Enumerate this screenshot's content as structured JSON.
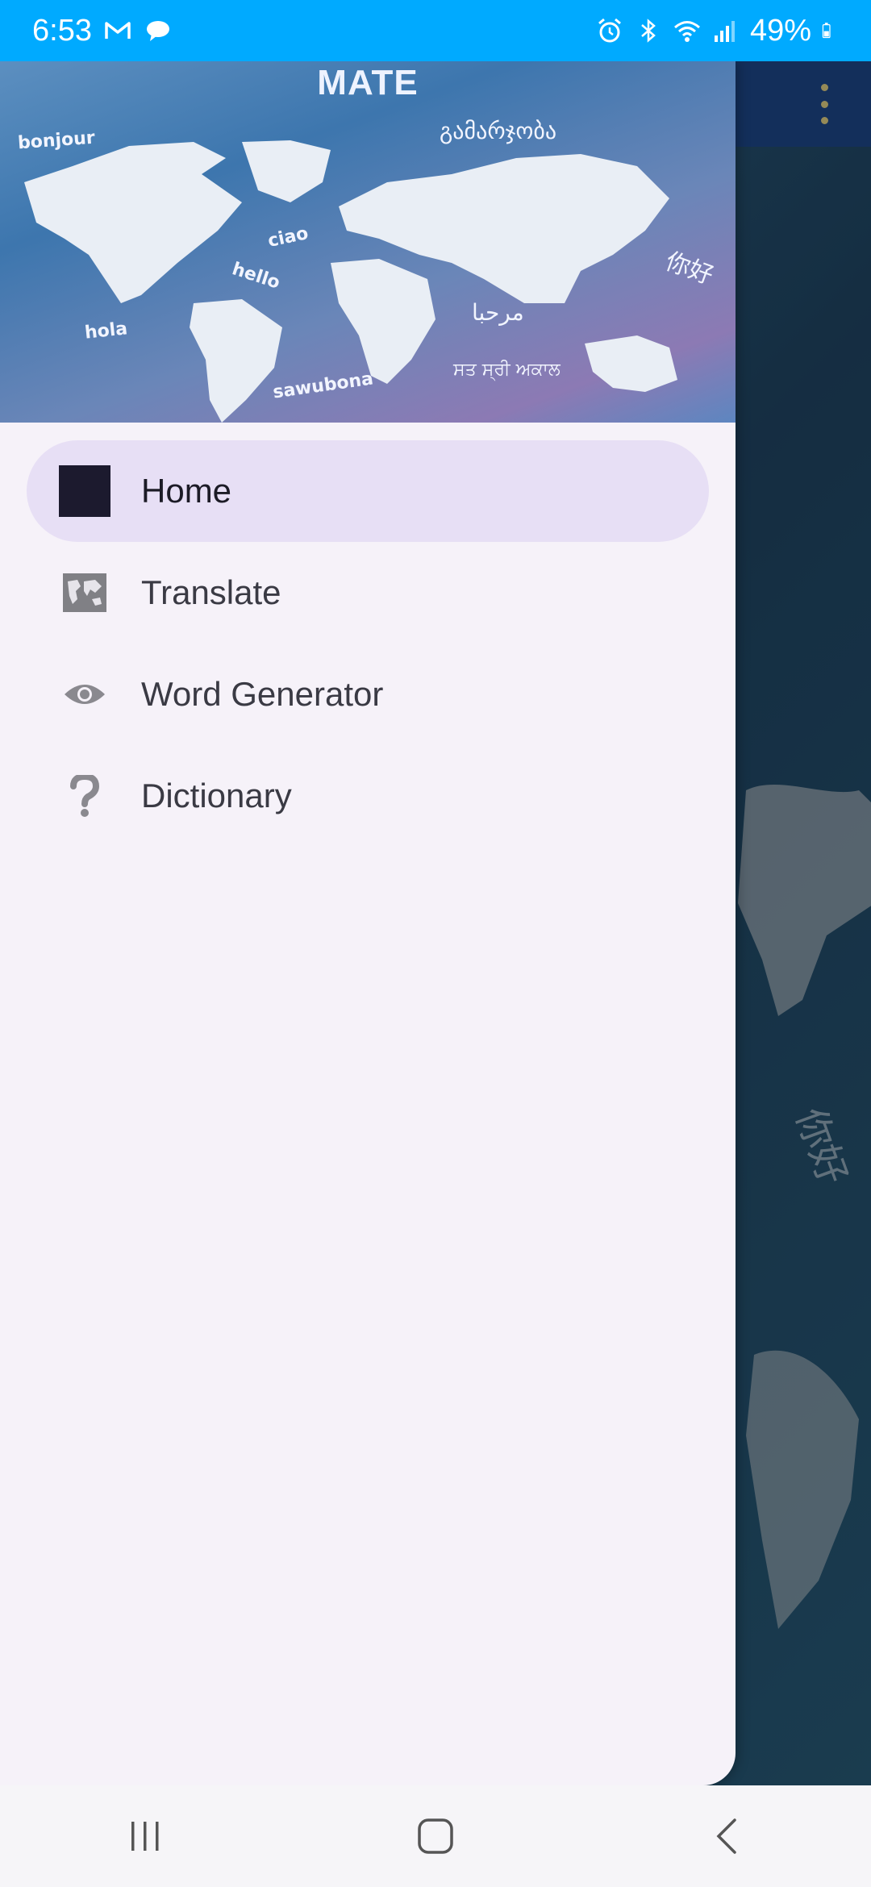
{
  "status_bar": {
    "time": "6:53",
    "battery": "49%",
    "icons": [
      "gmail-icon",
      "chat-icon",
      "alarm-icon",
      "bluetooth-icon",
      "wifi-icon",
      "signal-icon",
      "battery-icon"
    ],
    "color": "#00aaff"
  },
  "drawer": {
    "header": {
      "title": "MATE",
      "words": [
        "bonjour",
        "ciao",
        "hello",
        "hola",
        "sawubona",
        "გამარჯობა",
        "你好",
        "مرحبا",
        "ਸਤ ਸ੍ਰੀ ਅਕਾਲ"
      ]
    },
    "items": [
      {
        "label": "Home",
        "icon": "home-icon",
        "active": true
      },
      {
        "label": "Translate",
        "icon": "map-icon",
        "active": false
      },
      {
        "label": "Word Generator",
        "icon": "eye-icon",
        "active": false
      },
      {
        "label": "Dictionary",
        "icon": "question-icon",
        "active": false
      }
    ],
    "active_color": "#e7dff5"
  },
  "background_app": {
    "overflow_menu_icon": "more-vert-icon",
    "word": "你好"
  },
  "nav_bar": {
    "buttons": [
      "recents-button",
      "home-button",
      "back-button"
    ]
  }
}
